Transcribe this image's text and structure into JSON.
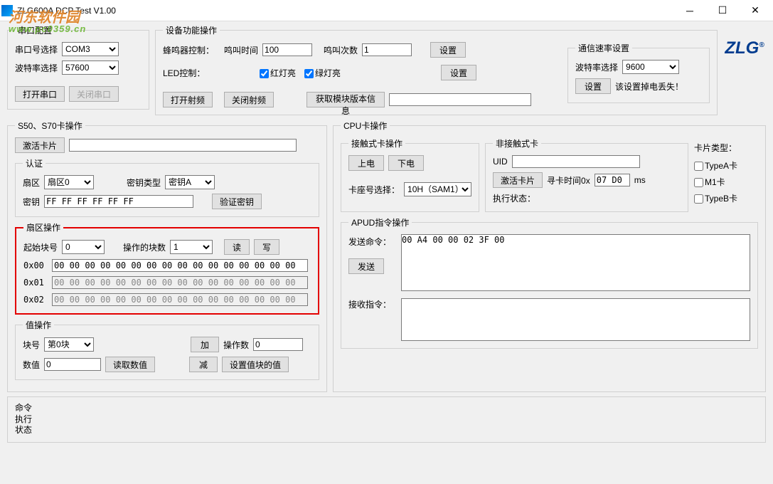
{
  "window": {
    "title": "ZLG600A DCP Test V1.00"
  },
  "watermark": {
    "line1": "河东软件园",
    "line2": "www.pc0359.cn"
  },
  "logo": {
    "text": "ZLG"
  },
  "serial": {
    "legend": "串口配置",
    "port_label": "串口号选择",
    "port_value": "COM3",
    "baud_label": "波特率选择",
    "baud_value": "57600",
    "open_btn": "打开串口",
    "close_btn": "关闭串口"
  },
  "device": {
    "legend": "设备功能操作",
    "buzzer_label": "蜂鸣器控制：",
    "buzz_time_label": "鸣叫时间",
    "buzz_time_value": "100",
    "buzz_count_label": "鸣叫次数",
    "buzz_count_value": "1",
    "set_btn": "设置",
    "led_label": "LED控制：",
    "red_led": "红灯亮",
    "green_led": "绿灯亮",
    "rate": {
      "legend": "通信速率设置",
      "baud_label": "波特率选择",
      "baud_value": "9600",
      "set_btn": "设置",
      "warn": "该设置掉电丢失！"
    },
    "rf_on": "打开射频",
    "rf_off": "关闭射频",
    "get_ver": "获取模块版本信息",
    "ver_value": ""
  },
  "s50": {
    "legend": "S50、S70卡操作",
    "activate_btn": "激活卡片",
    "activate_value": "",
    "auth": {
      "legend": "认证",
      "sector_label": "扇区",
      "sector_value": "扇区0",
      "keytype_label": "密钥类型",
      "keytype_value": "密钥A",
      "key_label": "密钥",
      "key_value": "FF FF FF FF FF FF",
      "verify_btn": "验证密钥"
    },
    "sector_ops": {
      "legend": "扇区操作",
      "start_label": "起始块号",
      "start_value": "0",
      "count_label": "操作的块数",
      "count_value": "1",
      "read_btn": "读",
      "write_btn": "写",
      "blocks": [
        {
          "addr": "0x00",
          "value": "00 00 00 00 00 00 00 00 00 00 00 00 00 00 00 00"
        },
        {
          "addr": "0x01",
          "value": "00 00 00 00 00 00 00 00 00 00 00 00 00 00 00 00"
        },
        {
          "addr": "0x02",
          "value": "00 00 00 00 00 00 00 00 00 00 00 00 00 00 00 00"
        }
      ]
    },
    "value_ops": {
      "legend": "值操作",
      "block_label": "块号",
      "block_value": "第0块",
      "val_label": "数值",
      "val_value": "0",
      "read_val_btn": "读取数值",
      "add_btn": "加",
      "sub_btn": "减",
      "op_count_label": "操作数",
      "op_count_value": "0",
      "set_val_btn": "设置值块的值"
    }
  },
  "cpu": {
    "legend": "CPU卡操作",
    "contact": {
      "legend": "接触式卡操作",
      "power_on": "上电",
      "power_off": "下电",
      "slot_label": "卡座号选择：",
      "slot_value": "10H（SAM1）"
    },
    "contactless": {
      "legend": "非接触式卡",
      "uid_label": "UID",
      "uid_value": "",
      "activate_btn": "激活卡片",
      "seek_label": "寻卡时间0x",
      "seek_value": "07 D0",
      "ms_label": "ms",
      "status_label": "执行状态："
    },
    "cardtype": {
      "label": "卡片类型：",
      "typea": "TypeA卡",
      "m1": "M1卡",
      "typeb": "TypeB卡"
    },
    "apdu": {
      "legend": "APUD指令操作",
      "send_label": "发送命令：",
      "send_value": "00 A4 00 00 02 3F 00",
      "send_btn": "发送",
      "recv_label": "接收指令："
    }
  },
  "status": {
    "label": "命令\n执行\n状态"
  }
}
